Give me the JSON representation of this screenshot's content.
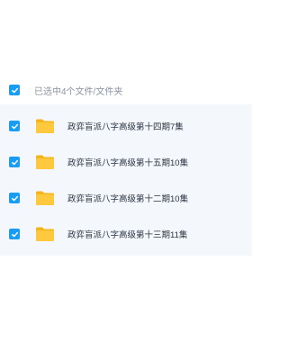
{
  "selection": {
    "summary_label": "已选中4个文件/文件夹"
  },
  "files": [
    {
      "name": "政弈盲派八字高级第十四期7集",
      "checked": true,
      "icon": "folder-icon"
    },
    {
      "name": "政弈盲派八字高级第十五期10集",
      "checked": true,
      "icon": "folder-icon"
    },
    {
      "name": "政弈盲派八字高级第十二期10集",
      "checked": true,
      "icon": "folder-icon"
    },
    {
      "name": "政弈盲派八字高级第十三期11集",
      "checked": true,
      "icon": "folder-icon"
    }
  ],
  "colors": {
    "checkbox": "#1a9cf0",
    "folder": "#ffc83d",
    "list_background": "#f4f8fc"
  }
}
